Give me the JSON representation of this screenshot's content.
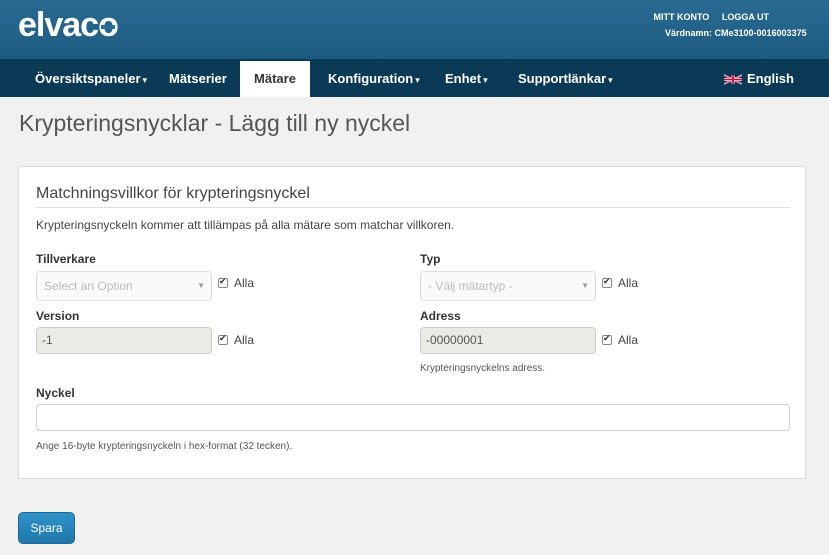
{
  "header": {
    "logo_text_start": "elvac",
    "logo_text_end": "o",
    "account_label": "MITT KONTO",
    "logout_label": "LOGGA UT",
    "hostname": "Värdnamn: CMe3100-0016003375"
  },
  "nav": {
    "items": [
      {
        "label": "Översiktspaneler",
        "caret": "▾"
      },
      {
        "label": "Mätserier",
        "caret": ""
      },
      {
        "label": "Mätare",
        "caret": ""
      },
      {
        "label": "Konfiguration",
        "caret": "▾"
      },
      {
        "label": "Enhet",
        "caret": "▾"
      },
      {
        "label": "Supportlänkar",
        "caret": "▾"
      }
    ],
    "active_index": 2,
    "language": "English"
  },
  "page": {
    "title": "Krypteringsnycklar - Lägg till ny nyckel"
  },
  "form": {
    "section_title": "Matchningsvillkor för krypteringsnyckel",
    "intro": "Krypteringsnyckeln kommer att tillämpas på alla mätare som matchar villkoren.",
    "manufacturer": {
      "label": "Tillverkare",
      "placeholder": "Select an Option",
      "all_label": "Alla"
    },
    "type": {
      "label": "Typ",
      "placeholder": "- Välj mätartyp -",
      "all_label": "Alla"
    },
    "version": {
      "label": "Version",
      "value": "-1",
      "all_label": "Alla"
    },
    "address": {
      "label": "Adress",
      "value": "-00000001",
      "all_label": "Alla",
      "help": "Krypteringsnyckelns adress."
    },
    "key": {
      "label": "Nyckel",
      "value": "",
      "help": "Ange 16-byte krypteringsnyckeln i hex-format (32 tecken)."
    }
  },
  "actions": {
    "save_label": "Spara"
  },
  "colors": {
    "header_bg": "#1d5a80",
    "nav_bg": "#0b3a57",
    "button_bg": "#2484bb"
  }
}
